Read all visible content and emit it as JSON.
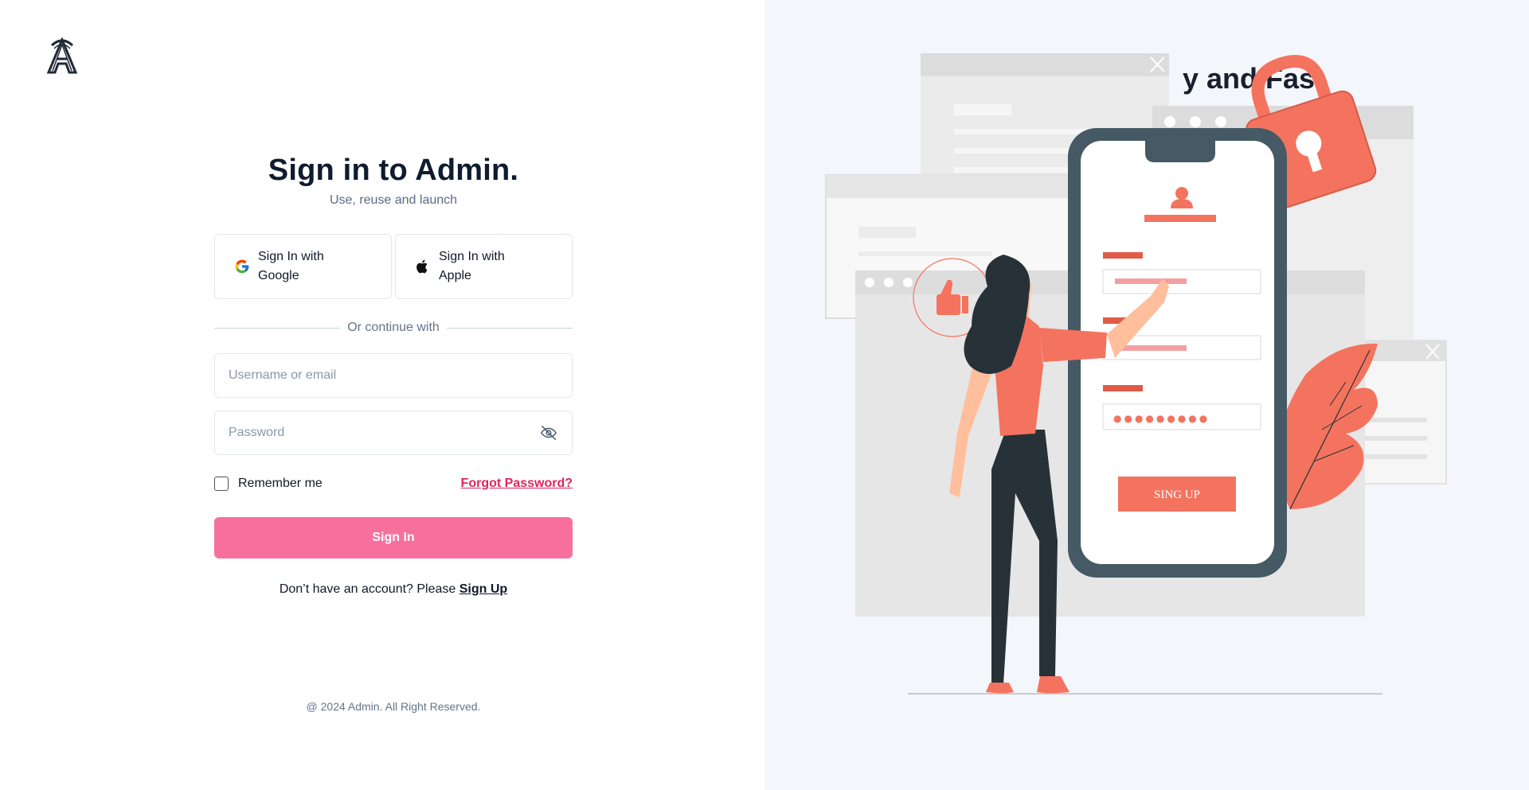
{
  "brand": {
    "logo_letter": "A"
  },
  "login": {
    "title": "Sign in to Admin.",
    "subtitle": "Use, reuse and launch",
    "social": {
      "google_label": "Sign In with Google",
      "apple_label": "Sign In with Apple"
    },
    "divider_text": "Or continue with",
    "username": {
      "placeholder": "Username or email",
      "value": ""
    },
    "password": {
      "placeholder": "Password",
      "value": ""
    },
    "remember_label": "Remember me",
    "remember_checked": false,
    "forgot_label": "Forgot Password?",
    "signin_label": "Sign In",
    "signup_prompt": "Don’t have an account? Please ",
    "signup_label": "Sign Up"
  },
  "footer": {
    "text": "@ 2024 Admin. All Right Reserved."
  },
  "hero": {
    "heading_visible": "y and Fast",
    "illustration": {
      "button_label": "SING UP",
      "password_dots": "●●●●●●●●●"
    }
  },
  "colors": {
    "accent": "#f7709d",
    "link": "#e0245e",
    "illustration_primary": "#f4735f",
    "phone_frame": "#455a64",
    "right_bg": "#f3f6fb"
  }
}
